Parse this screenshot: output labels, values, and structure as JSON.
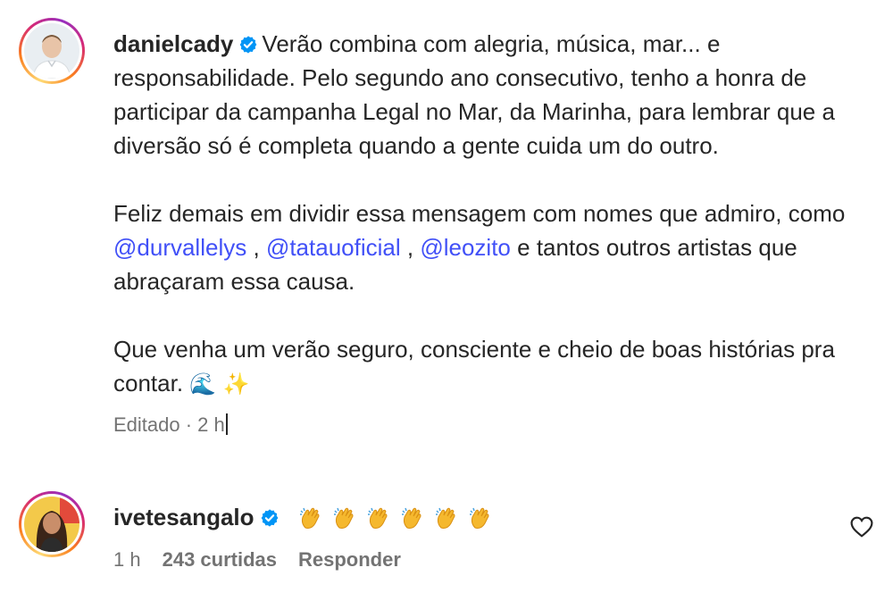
{
  "post": {
    "username": "danielcady",
    "text_p1": "Verão combina com alegria, música, mar... e responsabilidade. Pelo segundo ano consecutivo, tenho a honra de participar da campanha Legal no Mar, da Marinha, para lembrar que a diversão só é completa quando a gente cuida um do outro.",
    "text_p2_pre": "Feliz demais em dividir essa mensagem com nomes que admiro, como",
    "mentions": [
      "@durvallelys",
      "@tatauoficial",
      "@leozito"
    ],
    "sep1": ",",
    "sep2": ",",
    "text_p2_post": "e tantos outros artistas que abraçaram essa causa.",
    "text_p3": "Que venha um verão seguro, consciente e cheio de boas histórias pra contar.",
    "emojis": "🌊 ✨",
    "meta": "Editado · 2 h"
  },
  "comment": {
    "username": "ivetesangalo",
    "emoji_count_label": "👏👏👏👏👏👏",
    "time": "1 h",
    "likes": "243 curtidas",
    "reply": "Responder"
  },
  "icons": {
    "verified": "verified-badge-icon",
    "heart": "heart-outline-icon",
    "clap": "clapping-hands-emoji"
  },
  "colors": {
    "mention": "#4150f7",
    "verified": "#0095f6",
    "muted": "#737373"
  }
}
